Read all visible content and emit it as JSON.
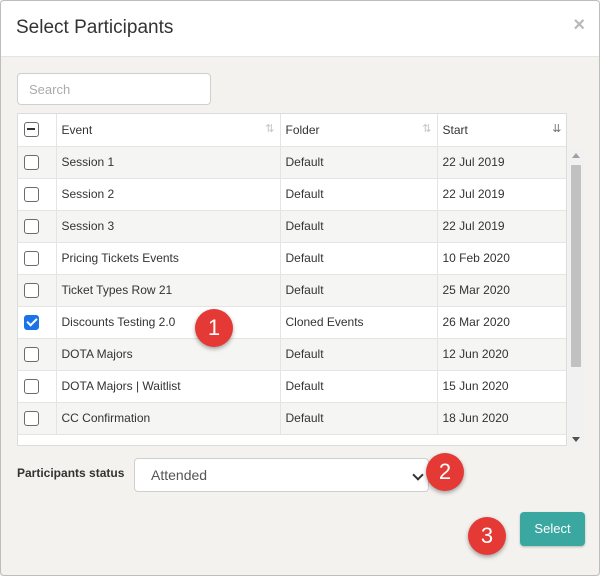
{
  "dialog": {
    "title": "Select Participants",
    "close": "×"
  },
  "search": {
    "placeholder": "Search",
    "value": ""
  },
  "table": {
    "headers": {
      "event": "Event",
      "folder": "Folder",
      "start": "Start"
    },
    "sort_icon": "⇅",
    "sort_active_icon": "⇊",
    "rows": [
      {
        "checked": false,
        "event": "Session 1",
        "folder": "Default",
        "start": "22 Jul 2019"
      },
      {
        "checked": false,
        "event": "Session 2",
        "folder": "Default",
        "start": "22 Jul 2019"
      },
      {
        "checked": false,
        "event": "Session 3",
        "folder": "Default",
        "start": "22 Jul 2019"
      },
      {
        "checked": false,
        "event": "Pricing Tickets Events",
        "folder": "Default",
        "start": "10 Feb 2020"
      },
      {
        "checked": false,
        "event": "Ticket Types Row 21",
        "folder": "Default",
        "start": "25 Mar 2020"
      },
      {
        "checked": true,
        "event": "Discounts Testing 2.0",
        "folder": "Cloned Events",
        "start": "26 Mar 2020"
      },
      {
        "checked": false,
        "event": "DOTA Majors",
        "folder": "Default",
        "start": "12 Jun 2020"
      },
      {
        "checked": false,
        "event": "DOTA Majors | Waitlist",
        "folder": "Default",
        "start": "15 Jun 2020"
      },
      {
        "checked": false,
        "event": "CC Confirmation",
        "folder": "Default",
        "start": "18 Jun 2020"
      }
    ]
  },
  "status": {
    "label": "Participants status",
    "selected": "Attended"
  },
  "select_button": "Select",
  "badges": [
    "1",
    "2",
    "3"
  ],
  "colors": {
    "accent": "#3aa8a0",
    "badge": "#e53935",
    "checkbox": "#1a73e8"
  }
}
